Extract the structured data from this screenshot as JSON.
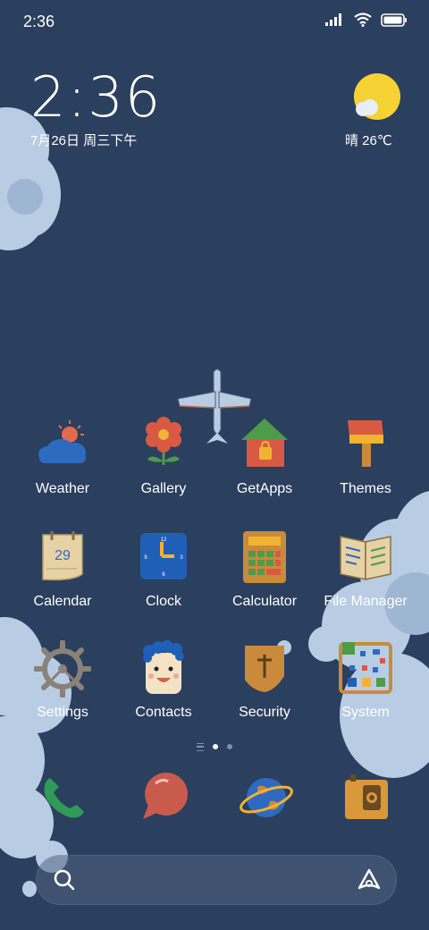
{
  "status_bar": {
    "time": "2:36",
    "icons": [
      "signal-icon",
      "wifi-icon",
      "battery-icon"
    ]
  },
  "clock_widget": {
    "time": "2:36",
    "date": "7月26日 周三下午"
  },
  "weather_widget": {
    "icon": "sun-cloud-icon",
    "text": "晴 26℃"
  },
  "apps": [
    {
      "label": "Weather",
      "icon": "cloud-sun-icon"
    },
    {
      "label": "Gallery",
      "icon": "flower-icon"
    },
    {
      "label": "GetApps",
      "icon": "house-icon"
    },
    {
      "label": "Themes",
      "icon": "paint-brush-icon"
    },
    {
      "label": "Calendar",
      "icon": "calendar-icon",
      "day": "29"
    },
    {
      "label": "Clock",
      "icon": "clock-icon"
    },
    {
      "label": "Calculator",
      "icon": "calculator-icon"
    },
    {
      "label": "File Manager",
      "icon": "open-book-icon"
    },
    {
      "label": "Settings",
      "icon": "gear-icon"
    },
    {
      "label": "Contacts",
      "icon": "face-icon"
    },
    {
      "label": "Security",
      "icon": "shield-icon"
    },
    {
      "label": "System",
      "icon": "tools-grid-icon"
    }
  ],
  "page_indicator": {
    "pages": 2,
    "active": 1
  },
  "dock": [
    {
      "icon": "phone-icon"
    },
    {
      "icon": "message-bubble-icon"
    },
    {
      "icon": "globe-icon"
    },
    {
      "icon": "camera-icon"
    }
  ],
  "search_bar": {
    "left_icon": "search-icon",
    "right_icon": "assistant-icon"
  },
  "colors": {
    "background": "#2b3f5e",
    "cloud": "#b8cde4",
    "sun": "#f7d234"
  }
}
